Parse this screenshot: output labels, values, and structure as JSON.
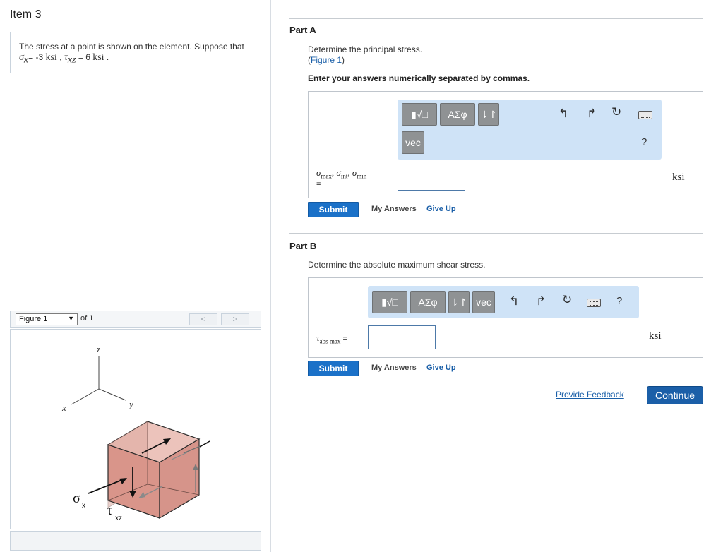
{
  "item_title": "Item 3",
  "problem": {
    "text_before": "The stress at a point is shown on the element. Suppose that ",
    "sigma_sym": "σ",
    "sigma_sub": "x",
    "eq1": "= -3 ",
    "unit1": "ksi",
    "sep": " , ",
    "tau_sym": "τ",
    "tau_sub": "xz",
    "eq2": " = 6 ",
    "unit2": "ksi",
    "end": " ."
  },
  "figure_nav": {
    "selected": "Figure 1",
    "of_text": "of 1",
    "prev": "<",
    "next": ">"
  },
  "figure_labels": {
    "z": "z",
    "y": "y",
    "x": "x",
    "sigma": "σ",
    "sigma_sub": "x",
    "tau": "τ",
    "tau_sub": "xz"
  },
  "part_a": {
    "title": "Part A",
    "instruction": "Determine the principal stress.",
    "figure_link": "Figure 1",
    "paren_open": "(",
    "paren_close": ")",
    "directive": "Enter your answers numerically separated by commas.",
    "toolbar": {
      "templates": "▮√□",
      "greek": "ΑΣφ",
      "arrows": "⇂↾",
      "vec": "vec",
      "help": "?"
    },
    "label_sym1": "σ",
    "label_sub1": "max",
    "label_sym2": "σ",
    "label_sub2": "int",
    "label_sym3": "σ",
    "label_sub3": "min",
    "label_comma": ", ",
    "label_eq": "=",
    "input_value": "",
    "unit": "ksi",
    "submit": "Submit",
    "my_answers": "My Answers",
    "give_up": "Give Up"
  },
  "part_b": {
    "title": "Part B",
    "instruction": "Determine the absolute maximum shear stress.",
    "toolbar": {
      "templates": "▮√□",
      "greek": "ΑΣφ",
      "arrows": "⇂↾",
      "vec": "vec",
      "help": "?"
    },
    "label_sym": "τ",
    "label_sub": "abs max",
    "label_eq": " =",
    "input_value": "",
    "unit": "ksi",
    "submit": "Submit",
    "my_answers": "My Answers",
    "give_up": "Give Up"
  },
  "footer": {
    "feedback": "Provide Feedback",
    "continue": "Continue"
  },
  "colors": {
    "primary_button": "#1b71c8",
    "toolbar_bg": "#cfe3f7",
    "cube_front": "#d9958a",
    "cube_top": "#ecc3bb",
    "cube_side": "#d6948a",
    "link": "#1a5fa8"
  }
}
